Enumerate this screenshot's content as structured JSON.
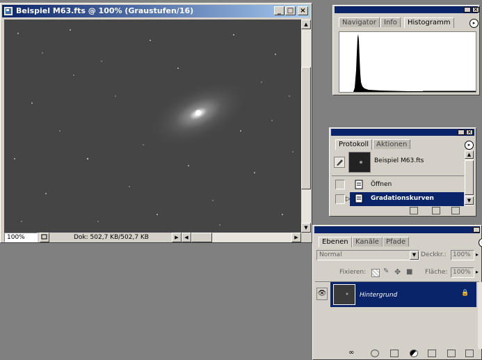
{
  "document_window": {
    "title": "Beispiel M63.fts @ 100% (Graustufen/16)",
    "zoom": "100%",
    "doc_info": "Dok: 502,7 KB/502,7 KB"
  },
  "navigator_panel": {
    "tabs": [
      {
        "label": "Navigator"
      },
      {
        "label": "Info"
      },
      {
        "label": "Histogramm"
      }
    ]
  },
  "history_panel": {
    "tabs": [
      {
        "label": "Protokoll"
      },
      {
        "label": "Aktionen"
      }
    ],
    "snapshot_label": "Beispiel M63.fts",
    "items": [
      {
        "label": "Öffnen"
      },
      {
        "label": "Gradationskurven"
      }
    ]
  },
  "layers_panel": {
    "tabs": [
      {
        "label": "Ebenen"
      },
      {
        "label": "Kanäle"
      },
      {
        "label": "Pfade"
      }
    ],
    "blend_mode": "Normal",
    "opacity_label": "Deckkr.:",
    "opacity_value": "100%",
    "lock_label": "Fixieren:",
    "fill_label": "Fläche:",
    "fill_value": "100%",
    "layer_name": "Hintergrund"
  },
  "colors": {
    "titlebar": "#0a246a",
    "selection": "#0a246a",
    "panel": "#d4d0c8",
    "workspace": "#808080"
  }
}
